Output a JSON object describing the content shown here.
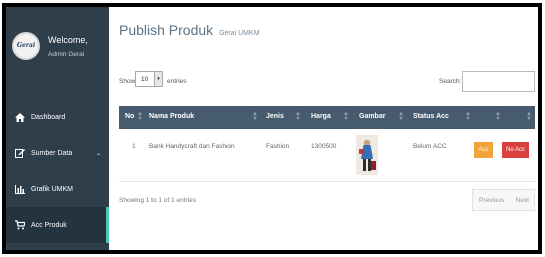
{
  "sidebar": {
    "logo_text": "Gerai",
    "welcome": "Welcome,",
    "user_name": "Admin Gerai",
    "items": [
      {
        "label": "Dashboard",
        "icon": "home-icon"
      },
      {
        "label": "Sumber Data",
        "icon": "edit-icon"
      },
      {
        "label": "Grafik UMKM",
        "icon": "bar-chart-icon"
      },
      {
        "label": "Acc Produk",
        "icon": "cart-icon"
      }
    ],
    "chevron": "⌄"
  },
  "main": {
    "title": "Publish Produk",
    "subtitle": "Gerai UMKM",
    "show_label": "Show",
    "page_size": "10",
    "entries_label": "entries",
    "search_label": "Search:",
    "search_value": "",
    "table": {
      "headers": [
        "No",
        "Nama Produk",
        "Jenis",
        "Harga",
        "Gambar",
        "Status Acc",
        "",
        ""
      ],
      "rows": [
        {
          "no": "1",
          "nama": "Bank Handycraft dan Fashion",
          "jenis": "Fashion",
          "harga": "1300500",
          "status": "Belum ACC",
          "acc_label": "Acc",
          "noacc_label": "No Acc"
        }
      ]
    },
    "showing": "Showing 1 to 1 of 1 entries",
    "pager": {
      "previous": "Previous",
      "next": "Next"
    }
  },
  "colors": {
    "sidebar_bg": "#2f3e4b",
    "table_header_bg": "#465b6e",
    "acc_button": "#f3a33b",
    "noacc_button": "#d9413f",
    "active_accent": "#4fc4b8"
  }
}
